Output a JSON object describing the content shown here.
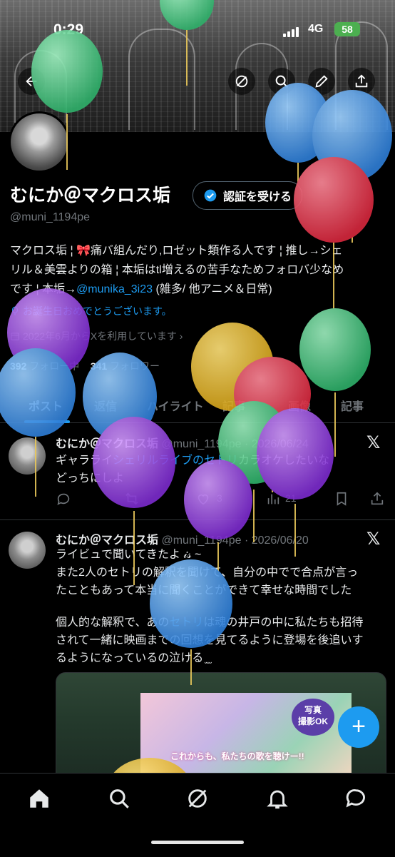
{
  "status_bar": {
    "time": "0:29",
    "network": "4G",
    "battery": "58"
  },
  "profile": {
    "name": "むにか＠マクロス垢",
    "verify_label": "認証を受ける",
    "handle": "@muni_1194pe",
    "bio_line1": "マクロス垢 ¦ 🎀痛バ組んだり,ロゼット類作る人です ¦ 推し→シェ",
    "bio_line2": "リル＆美雲よりの箱 ¦ 本垢はtl増えるの苦手なためフォロバ少なめ",
    "bio_line3_prefix": "です ¦ 本垢→",
    "bio_mention": "@munika_3i23",
    "bio_line3_suffix": " (雑多/ 他アニメ＆日常)",
    "birthday": "お誕生日おめでとうございます。",
    "joined": "2022年6月からXを利用しています",
    "following_count": "392",
    "following_label": "フォロー中",
    "followers_count": "341",
    "followers_label": "フォロワー"
  },
  "tabs": [
    "ポスト",
    "返信",
    "ハイライト",
    "記事",
    "画像",
    "記事"
  ],
  "posts": [
    {
      "name": "むにか＠マクロス垢",
      "handle": "@muni_1194pe",
      "date": "2026/06/24",
      "text1": "ギャラライ",
      "text_hl": "シェリルライブのセトリ",
      "text2": "カラオケしたいな",
      "text3": "どっちにしよ",
      "likes": "3",
      "views": "21"
    },
    {
      "name": "むにか＠マクロス垢",
      "handle": "@muni_1194pe",
      "date": "2026/06/20",
      "line1": "ライビュで聞いてきたよ 𝒾𝓈 ~",
      "line2": "また2人のセトリの解釈を聞けて、自分の中でで合点が言っ",
      "line3": "たこともあって本当に聞くことができて幸せな時間でした",
      "line4": "個人的な解釈で、あの",
      "line4_hl": "セトリ",
      "line4b": "は魂の井戸の中に私たちも招待",
      "line5": "されて一緒に映画までの回想を見てるように登場を後追いす",
      "line6": "るようになっているの泣ける ̫ ̫",
      "media_badge_1": "写真",
      "media_badge_2": "撮影OK",
      "media_caption": "これからも、私たちの歌を聴けー!!"
    }
  ],
  "icons": {
    "back": "back-arrow-icon",
    "grok": "grok-icon",
    "search": "search-icon",
    "edit": "pencil-icon",
    "share": "share-icon",
    "x_logo": "x-logo-icon",
    "compose": "plus-icon"
  },
  "colors": {
    "accent": "#1d9bf0",
    "background": "#000000",
    "muted": "#71767b"
  }
}
